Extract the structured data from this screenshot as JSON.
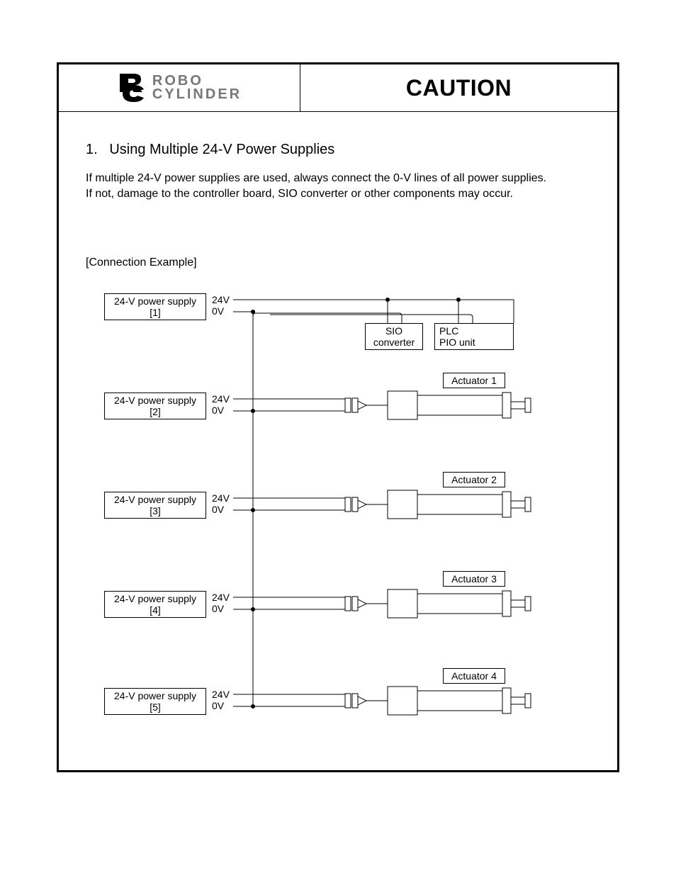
{
  "header": {
    "logo_line1": "ROBO",
    "logo_line2": "CYLINDER",
    "caution": "CAUTION"
  },
  "section": {
    "number": "1.",
    "title": "Using Multiple 24-V Power Supplies",
    "body_line1": "If multiple 24-V power supplies are used, always connect the 0-V lines of all power supplies.",
    "body_line2": "If not, damage to the controller board, SIO converter or other components may occur.",
    "subtitle": "[Connection Example]"
  },
  "diagram": {
    "ps1": "24-V power supply",
    "ps1_num": "[1]",
    "ps2": "24-V power supply",
    "ps2_num": "[2]",
    "ps3": "24-V power supply",
    "ps3_num": "[3]",
    "ps4": "24-V power supply",
    "ps4_num": "[4]",
    "ps5": "24-V power supply",
    "ps5_num": "[5]",
    "v24": "24V",
    "v0": "0V",
    "sio_l1": "SIO",
    "sio_l2": "converter",
    "plc_l1": "PLC",
    "plc_l2": "PIO unit",
    "act1": "Actuator 1",
    "act2": "Actuator 2",
    "act3": "Actuator 3",
    "act4": "Actuator 4"
  }
}
